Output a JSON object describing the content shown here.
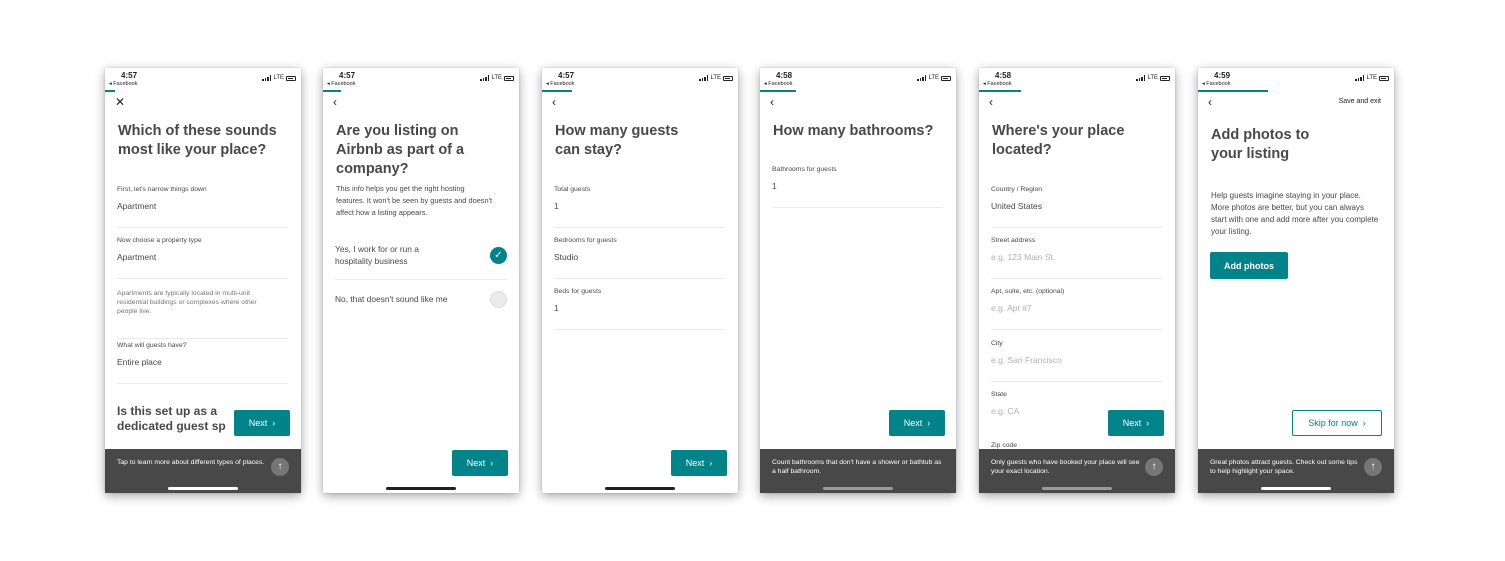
{
  "colors": {
    "accent": "#008489",
    "text": "#484848",
    "bottom_bar": "#484848"
  },
  "common": {
    "back_app_label": "◂ Facebook",
    "signal_label": "LTE",
    "next_label": "Next",
    "chevron": "›"
  },
  "screens": [
    {
      "time": "4:57",
      "nav_icon": "close-icon",
      "title": "Which of these sounds most like your place?",
      "fields": [
        {
          "label": "First, let's narrow things down",
          "value": "Apartment"
        },
        {
          "label": "Now choose a property type",
          "value": "Apartment"
        },
        {
          "note": "Apartments are typically located in multi-unit residential buildings or complexes where other people live."
        },
        {
          "label": "What will guests have?",
          "value": "Entire place"
        }
      ],
      "cut_heading": "Is this set up as a dedicated guest sp",
      "bottom_tip": "Tap to learn more about different types of places."
    },
    {
      "time": "4:57",
      "nav_icon": "back-icon",
      "title": "Are you listing on Airbnb as part of a company?",
      "subtitle": "This info helps you get the right hosting features. It won't be seen by guests and doesn't affect how a listing appears.",
      "options": [
        {
          "label": "Yes, I work for or run a hospitality business",
          "selected": true
        },
        {
          "label": "No, that doesn't sound like me",
          "selected": false
        }
      ]
    },
    {
      "time": "4:57",
      "nav_icon": "back-icon",
      "title": "How many guests can stay?",
      "fields": [
        {
          "label": "Total guests",
          "value": "1"
        },
        {
          "label": "Bedrooms for guests",
          "value": "Studio"
        },
        {
          "label": "Beds for guests",
          "value": "1"
        }
      ]
    },
    {
      "time": "4:58",
      "nav_icon": "back-icon",
      "title": "How many bathrooms?",
      "fields": [
        {
          "label": "Bathrooms for guests",
          "value": "1"
        }
      ],
      "bottom_tip": "Count bathrooms that don't have a shower or bathtub as a half bathroom."
    },
    {
      "time": "4:58",
      "nav_icon": "back-icon",
      "title": "Where's your place located?",
      "fields": [
        {
          "label": "Country / Region",
          "value": "United States"
        },
        {
          "label": "Street address",
          "placeholder": "e.g. 123 Main St."
        },
        {
          "label": "Apt, suite, etc. (optional)",
          "placeholder": "e.g. Apt #7"
        },
        {
          "label": "City",
          "placeholder": "e.g. San Francisco"
        },
        {
          "label": "State",
          "placeholder": "e.g. CA"
        },
        {
          "label": "Zip code"
        }
      ],
      "bottom_tip": "Only guests who have booked your place will see your exact location."
    },
    {
      "time": "4:59",
      "nav_icon": "back-icon",
      "save_exit": "Save and exit",
      "title": "Add photos to your listing",
      "subtitle": "Help guests imagine staying in your place. More photos are better, but you can always start with one and add more after you complete your listing.",
      "primary_button": "Add photos",
      "skip_button": "Skip for now",
      "bottom_tip": "Great photos attract guests. Check out some tips to help highlight your space."
    }
  ]
}
